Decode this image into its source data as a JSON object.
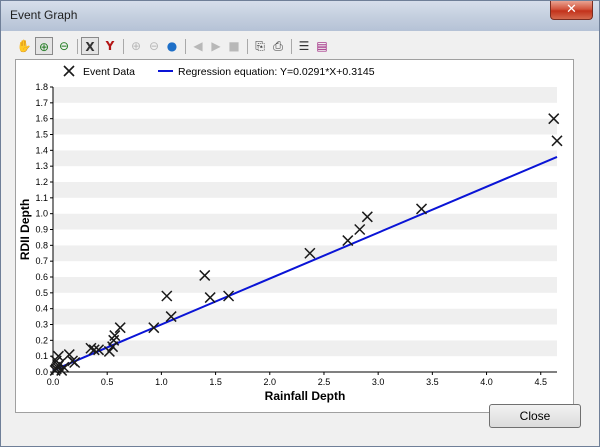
{
  "window": {
    "title": "Event Graph",
    "close_glyph": "✕"
  },
  "toolbar": {
    "icons": [
      "hand-pan-icon",
      "zoom-in-icon",
      "zoom-out-icon",
      "x-zoom-icon",
      "y-zoom-icon",
      "zoom-previous-icon",
      "zoom-next-icon",
      "globe-icon",
      "arrow-left-icon",
      "arrow-right-icon",
      "stop-icon",
      "copy-icon",
      "print-icon",
      "properties-icon",
      "books-icon"
    ],
    "glyphs": [
      "✋",
      "⊕",
      "⊖",
      "X",
      "Y",
      "⊕",
      "⊖",
      "●",
      "◀",
      "▶",
      "■",
      "⎘",
      "⎙",
      "☰",
      "▤"
    ]
  },
  "buttons": {
    "close_label": "Close"
  },
  "chart_data": {
    "type": "scatter",
    "xlabel": "Rainfall Depth",
    "ylabel": "RDII Depth",
    "xlim": [
      0,
      4.65
    ],
    "ylim": [
      0,
      1.8
    ],
    "xticks": [
      "0.0",
      "0.5",
      "1.0",
      "1.5",
      "2.0",
      "2.5",
      "3.0",
      "3.5",
      "4.0",
      "4.5"
    ],
    "yticks": [
      "0.0",
      "0.1",
      "0.2",
      "0.3",
      "0.4",
      "0.5",
      "0.6",
      "0.7",
      "0.8",
      "0.9",
      "1.0",
      "1.1",
      "1.2",
      "1.3",
      "1.4",
      "1.5",
      "1.6",
      "1.7",
      "1.8"
    ],
    "grid": "horizontal bands",
    "legend": {
      "position": "top",
      "entries": [
        "Event Data",
        "Regression equation: Y=0.0291*X+0.3145"
      ]
    },
    "series": [
      {
        "name": "Event Data",
        "marker": "x",
        "color": "#1a1a1a",
        "points": [
          [
            0.02,
            0.01
          ],
          [
            0.03,
            0.02
          ],
          [
            0.04,
            0.03
          ],
          [
            0.05,
            0.04
          ],
          [
            0.06,
            0.05
          ],
          [
            0.03,
            0.07
          ],
          [
            0.05,
            0.1
          ],
          [
            0.08,
            0.01
          ],
          [
            0.1,
            0.03
          ],
          [
            0.15,
            0.11
          ],
          [
            0.18,
            0.07
          ],
          [
            0.2,
            0.06
          ],
          [
            0.35,
            0.15
          ],
          [
            0.38,
            0.14
          ],
          [
            0.42,
            0.14
          ],
          [
            0.52,
            0.13
          ],
          [
            0.55,
            0.16
          ],
          [
            0.56,
            0.2
          ],
          [
            0.57,
            0.23
          ],
          [
            0.62,
            0.28
          ],
          [
            0.93,
            0.28
          ],
          [
            1.05,
            0.48
          ],
          [
            1.09,
            0.35
          ],
          [
            1.4,
            0.61
          ],
          [
            1.45,
            0.47
          ],
          [
            1.62,
            0.48
          ],
          [
            2.37,
            0.75
          ],
          [
            2.72,
            0.83
          ],
          [
            2.83,
            0.9
          ],
          [
            2.9,
            0.98
          ],
          [
            3.4,
            1.03
          ],
          [
            4.62,
            1.6
          ],
          [
            4.65,
            1.46
          ]
        ]
      }
    ],
    "regression": {
      "slope": 0.29,
      "intercept": 0.01,
      "x_start": 0,
      "x_end": 4.65,
      "color": "#0a14d6"
    }
  }
}
